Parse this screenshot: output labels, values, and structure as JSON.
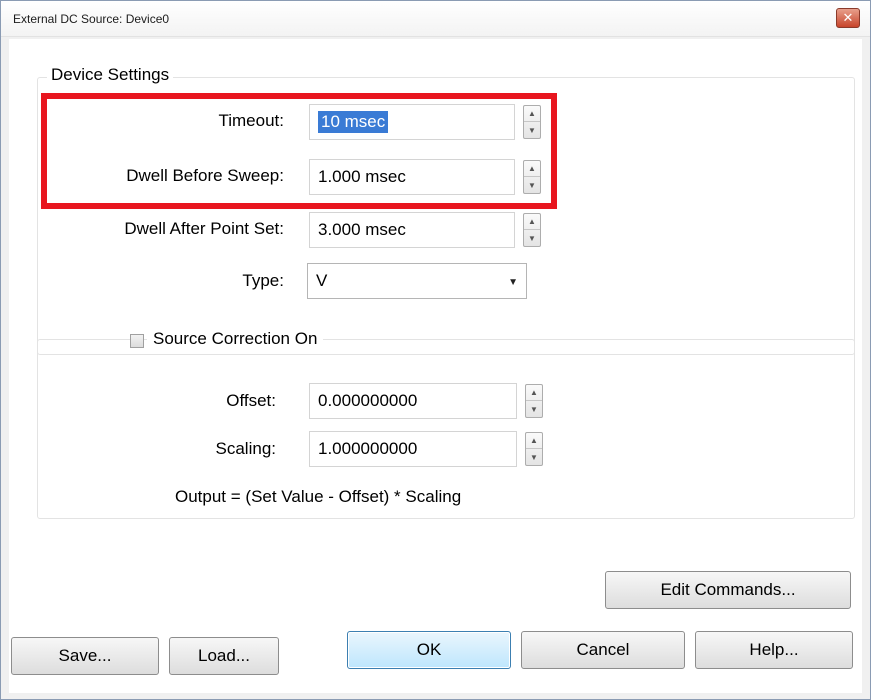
{
  "window": {
    "title": "External DC Source: Device0",
    "close_glyph": "✕"
  },
  "device_settings": {
    "legend": "Device Settings",
    "timeout": {
      "label": "Timeout:",
      "value": "10 msec"
    },
    "dwell_before": {
      "label": "Dwell Before Sweep:",
      "value": "1.000 msec"
    },
    "dwell_after": {
      "label": "Dwell After Point Set:",
      "value": "3.000 msec"
    },
    "type": {
      "label": "Type:",
      "value": "V"
    }
  },
  "source_correction": {
    "checkbox_label": "Source Correction On",
    "checked": false,
    "offset": {
      "label": "Offset:",
      "value": "0.000000000"
    },
    "scaling": {
      "label": "Scaling:",
      "value": "1.000000000"
    },
    "formula": "Output = (Set Value - Offset) * Scaling"
  },
  "buttons": {
    "edit_commands": "Edit Commands...",
    "save": "Save...",
    "load": "Load...",
    "ok": "OK",
    "cancel": "Cancel",
    "help": "Help..."
  },
  "icons": {
    "spin_up": "▲",
    "spin_down": "▼",
    "dropdown_arrow": "▼"
  },
  "colors": {
    "highlight_box": "#e8161f",
    "selection": "#3a7bd5",
    "close_button": "#c7442b"
  }
}
